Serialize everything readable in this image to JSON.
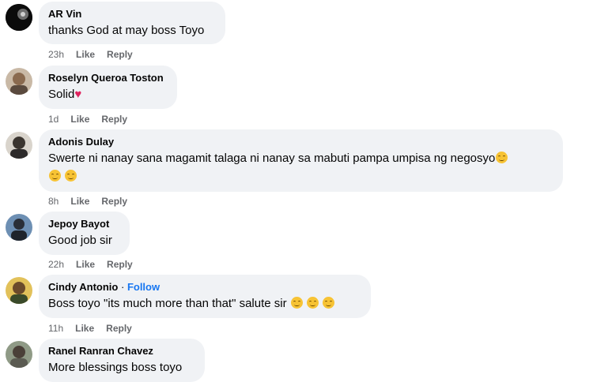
{
  "actions": {
    "like": "Like",
    "reply": "Reply"
  },
  "comments": [
    {
      "author": "AR Vin",
      "text": "thanks God at may boss Toyo",
      "time": "23h"
    },
    {
      "author": "Roselyn Queroa Toston",
      "text": "Solid",
      "time": "1d",
      "emoji": "red-heart"
    },
    {
      "author": "Adonis Dulay",
      "text": "Swerte ni nanay sana magamit talaga ni nanay sa mabuti pampa umpisa ng negosyo",
      "time": "8h",
      "emoji": "smiling-face"
    },
    {
      "author": "Jepoy Bayot",
      "text": "Good job sir",
      "time": "22h"
    },
    {
      "author": "Cindy Antonio",
      "follow": "Follow",
      "separator": "·",
      "text": "Boss toyo \"its much more than that\" salute sir",
      "time": "11h",
      "emoji": "smiling-face"
    },
    {
      "author": "Ranel Ranran Chavez",
      "text": "More blessings boss toyo"
    }
  ],
  "colors": {
    "bubble": "#f0f2f5",
    "meta": "#65676b",
    "link": "#1877f2",
    "heart": "#e0245e"
  }
}
